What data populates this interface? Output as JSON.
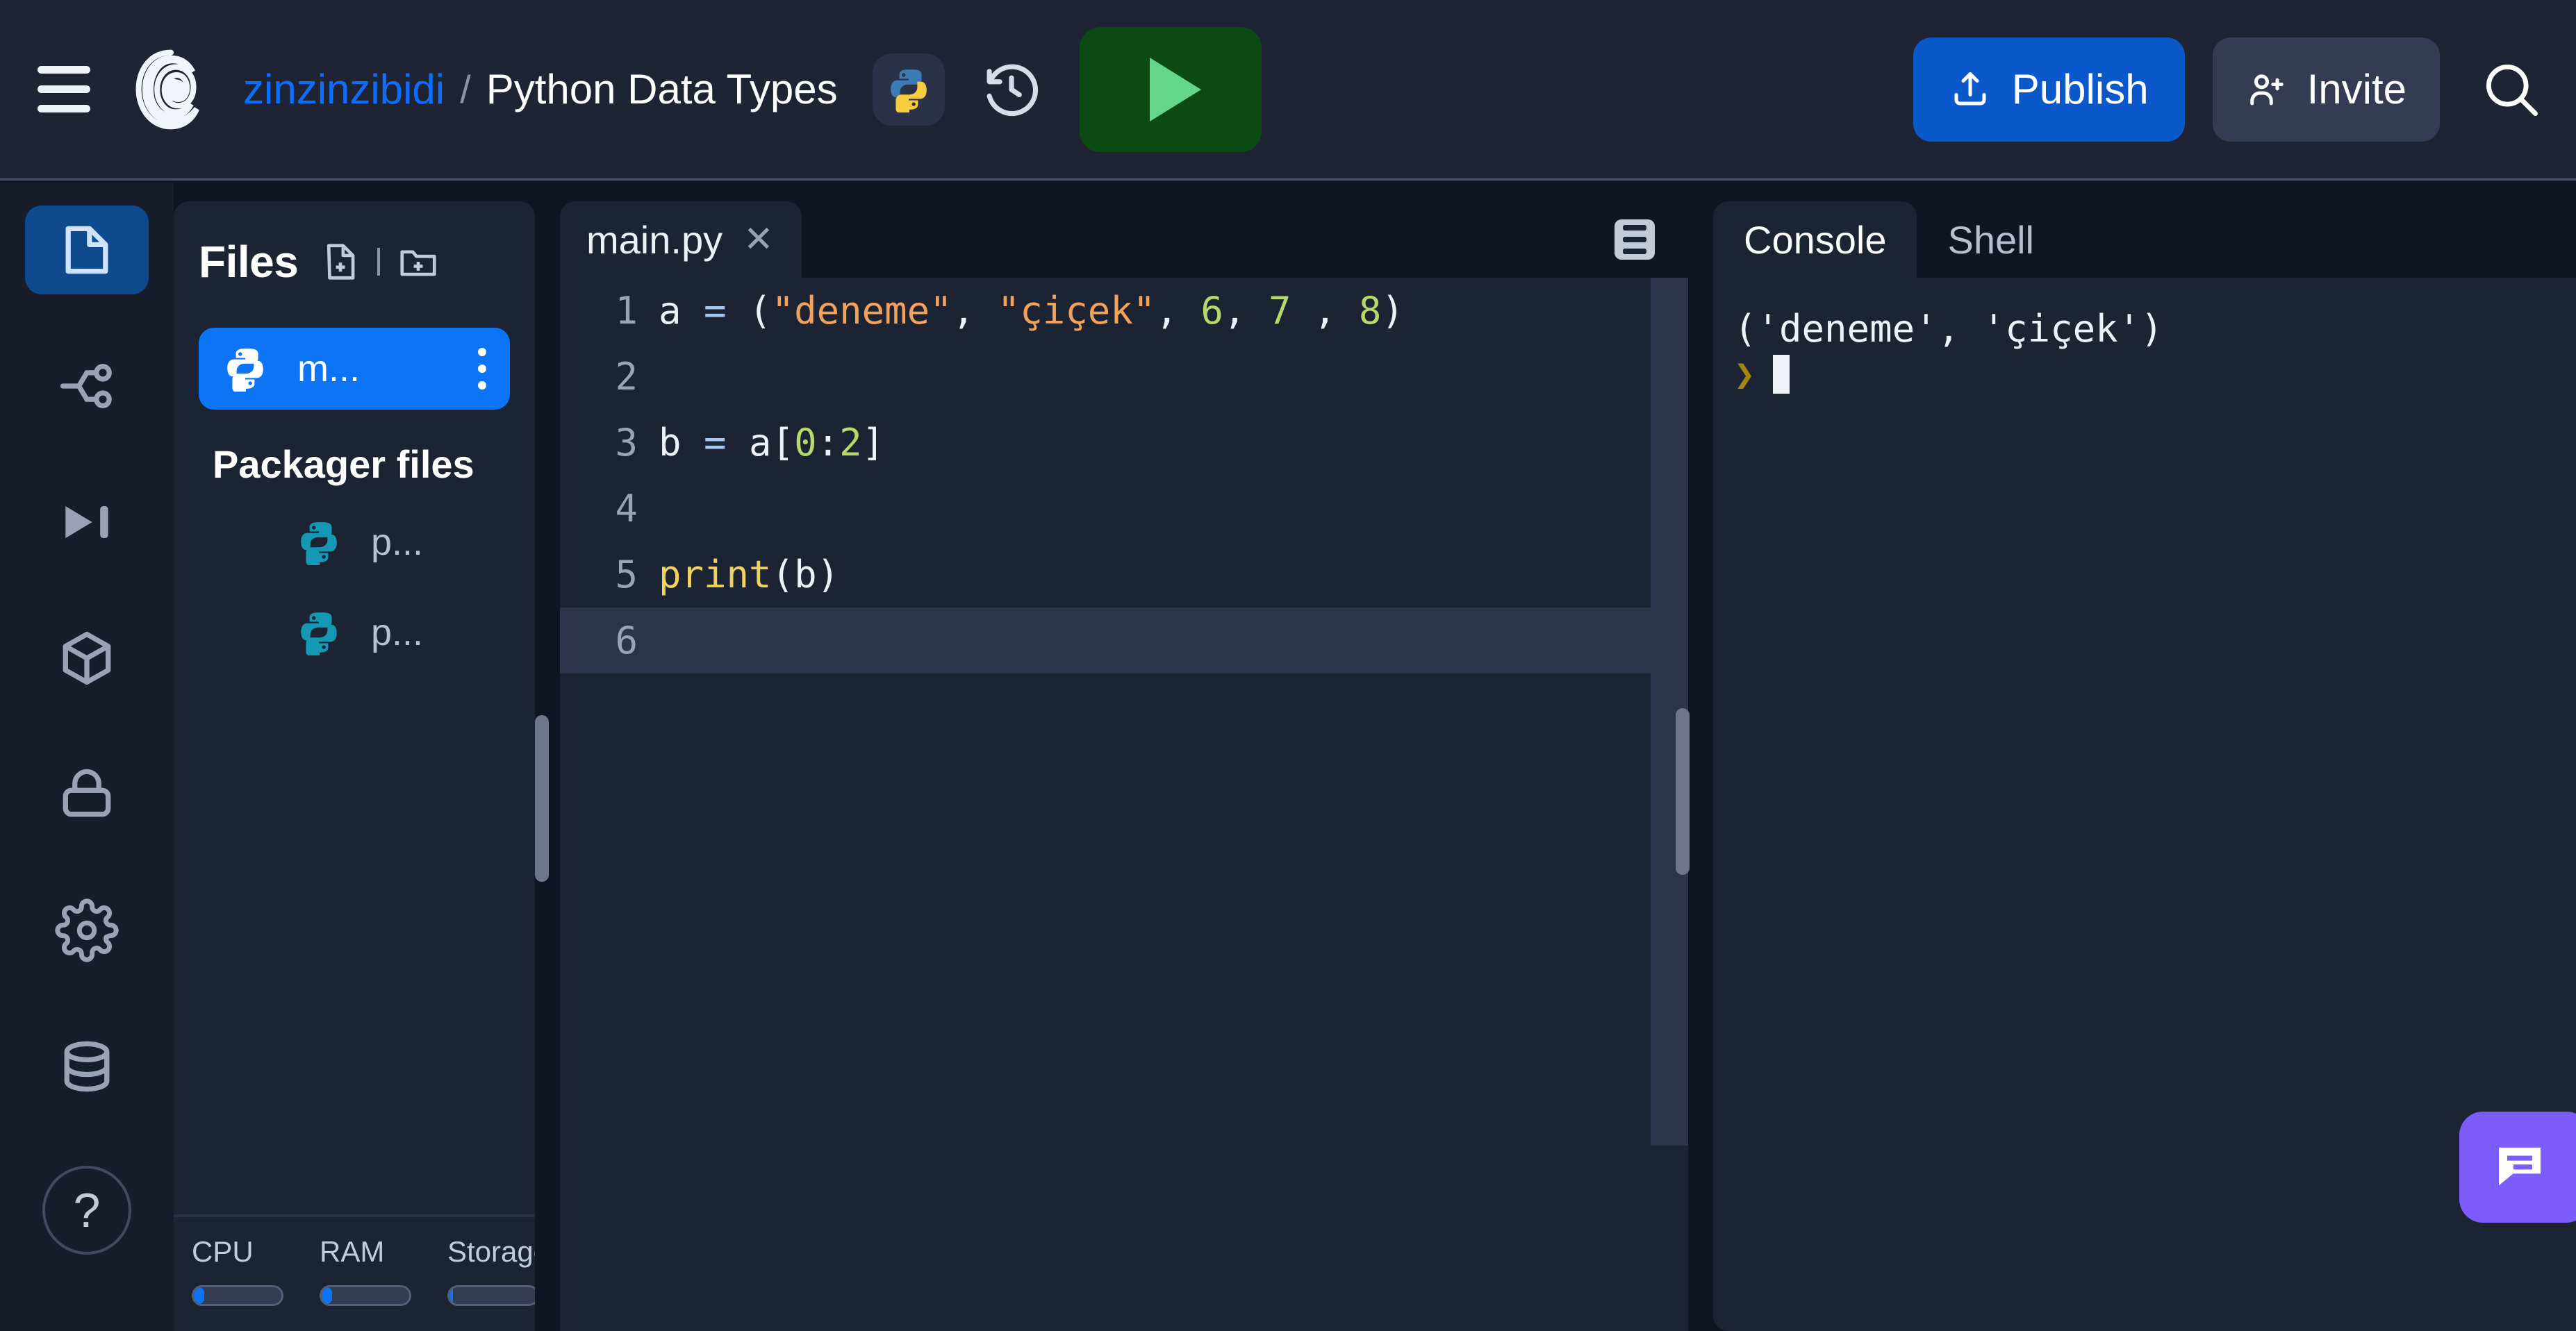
{
  "header": {
    "menu_icon": "hamburger-icon",
    "logo_icon": "replit-logo-icon",
    "username": "zinzinzibidi",
    "separator": "/",
    "project_title": "Python Data Types",
    "language_badge_icon": "python-logo-icon",
    "history_icon": "history-clock-icon",
    "run_icon": "play-triangle-icon",
    "publish_label": "Publish",
    "publish_icon": "upload-icon",
    "invite_label": "Invite",
    "invite_icon": "person-add-icon",
    "search_icon": "search-icon",
    "accent_blue": "#0d6efd",
    "publish_bg": "#0a58ca",
    "run_bg": "#0c4a14",
    "run_triangle": "#64d68a"
  },
  "rail": {
    "items": [
      {
        "icon": "file-page-icon",
        "name": "files",
        "active": true
      },
      {
        "icon": "git-branch-icon",
        "name": "git",
        "active": false
      },
      {
        "icon": "debugger-step-icon",
        "name": "debugger",
        "active": false
      },
      {
        "icon": "package-cube-icon",
        "name": "packages",
        "active": false
      },
      {
        "icon": "lock-icon",
        "name": "secrets",
        "active": false
      },
      {
        "icon": "gear-icon",
        "name": "settings",
        "active": false
      },
      {
        "icon": "database-icon",
        "name": "database",
        "active": false
      }
    ],
    "help_icon": "question-mark-icon",
    "active_bg": "#0f4a8f"
  },
  "files": {
    "title": "Files",
    "new_file_icon": "new-file-icon",
    "new_folder_icon": "new-folder-icon",
    "active_file": {
      "name": "m...",
      "icon": "python-file-icon",
      "kebab_icon": "kebab-menu-icon"
    },
    "packager_title": "Packager files",
    "packager_items": [
      {
        "name": "p...",
        "icon": "python-file-icon"
      },
      {
        "name": "p...",
        "icon": "python-file-icon"
      }
    ],
    "active_bg": "#0d74f5"
  },
  "resources": [
    {
      "label": "CPU",
      "fill_pct": 12
    },
    {
      "label": "RAM",
      "fill_pct": 12
    },
    {
      "label": "Storage",
      "fill_pct": 4
    }
  ],
  "editor": {
    "tab_name": "main.py",
    "tab_close_icon": "close-x-icon",
    "tools_icon": "editor-tools-icon",
    "lines": [
      {
        "num": "1",
        "active": false,
        "tokens": [
          {
            "t": "a ",
            "c": "pl"
          },
          {
            "t": "=",
            "c": "op"
          },
          {
            "t": " (",
            "c": "pl"
          },
          {
            "t": "\"deneme\"",
            "c": "str"
          },
          {
            "t": ", ",
            "c": "pl"
          },
          {
            "t": "\"çiçek\"",
            "c": "str"
          },
          {
            "t": ", ",
            "c": "pl"
          },
          {
            "t": "6",
            "c": "num"
          },
          {
            "t": ", ",
            "c": "pl"
          },
          {
            "t": "7",
            "c": "num"
          },
          {
            "t": " , ",
            "c": "pl"
          },
          {
            "t": "8",
            "c": "num"
          },
          {
            "t": ")",
            "c": "pl"
          }
        ]
      },
      {
        "num": "2",
        "active": false,
        "tokens": []
      },
      {
        "num": "3",
        "active": false,
        "tokens": [
          {
            "t": "b ",
            "c": "pl"
          },
          {
            "t": "=",
            "c": "op"
          },
          {
            "t": " a[",
            "c": "pl"
          },
          {
            "t": "0",
            "c": "num"
          },
          {
            "t": ":",
            "c": "pl"
          },
          {
            "t": "2",
            "c": "num"
          },
          {
            "t": "]",
            "c": "pl"
          }
        ]
      },
      {
        "num": "4",
        "active": false,
        "tokens": []
      },
      {
        "num": "5",
        "active": false,
        "tokens": [
          {
            "t": "print",
            "c": "fn"
          },
          {
            "t": "(b)",
            "c": "pl"
          }
        ]
      },
      {
        "num": "6",
        "active": true,
        "tokens": []
      }
    ]
  },
  "console": {
    "tabs": [
      {
        "label": "Console",
        "active": true
      },
      {
        "label": "Shell",
        "active": false
      }
    ],
    "output": "('deneme', 'çiçek')",
    "prompt_symbol": "❯",
    "cursor_visible": true
  },
  "chat": {
    "icon": "chat-bubble-icon",
    "bg": "#7c5cfa"
  }
}
